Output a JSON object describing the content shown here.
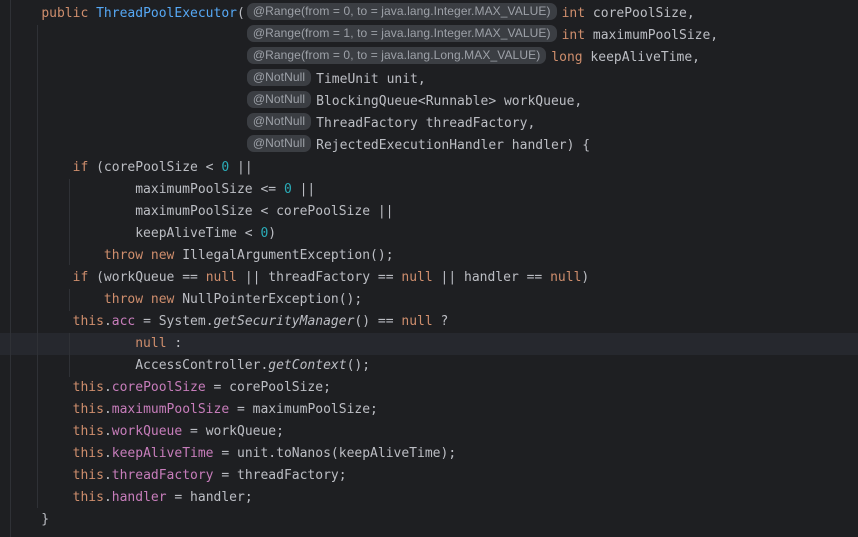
{
  "editor": {
    "background": "#1e1f22",
    "caret_line": {
      "index": 15,
      "color": "#26282e"
    },
    "palette": {
      "plain": "#bcbec4",
      "keyword": "#cf8e6d",
      "declaration": "#56a8f5",
      "number": "#2aacb8",
      "field": "#c77dbb",
      "hint_bg": "#3b3e43",
      "hint_fg": "#9da1a8",
      "guide": "#2f3136",
      "gutter_line": "#2e3035"
    },
    "lines": [
      {
        "segments": [
          {
            "t": "    ",
            "s": "plain"
          },
          {
            "t": "public",
            "s": "kw"
          },
          {
            "t": " ",
            "s": "plain"
          },
          {
            "t": "ThreadPoolExecutor",
            "s": "decl"
          },
          {
            "t": "(",
            "s": "plain"
          },
          {
            "t": "@Range(from = 0, to = java.lang.Integer.MAX_VALUE)",
            "s": "hint"
          },
          {
            "t": "int",
            "s": "kw"
          },
          {
            "t": " corePoolSize,",
            "s": "plain"
          }
        ]
      },
      {
        "segments": [
          {
            "t": "                              ",
            "s": "plain"
          },
          {
            "t": "@Range(from = 1, to = java.lang.Integer.MAX_VALUE)",
            "s": "hint"
          },
          {
            "t": "int",
            "s": "kw"
          },
          {
            "t": " maximumPoolSize,",
            "s": "plain"
          }
        ]
      },
      {
        "segments": [
          {
            "t": "                              ",
            "s": "plain"
          },
          {
            "t": "@Range(from = 0, to = java.lang.Long.MAX_VALUE)",
            "s": "hint"
          },
          {
            "t": "long",
            "s": "kw"
          },
          {
            "t": " keepAliveTime,",
            "s": "plain"
          }
        ]
      },
      {
        "segments": [
          {
            "t": "                              ",
            "s": "plain"
          },
          {
            "t": "@NotNull",
            "s": "hint"
          },
          {
            "t": "TimeUnit unit,",
            "s": "plain"
          }
        ]
      },
      {
        "segments": [
          {
            "t": "                              ",
            "s": "plain"
          },
          {
            "t": "@NotNull",
            "s": "hint"
          },
          {
            "t": "BlockingQueue<Runnable> workQueue,",
            "s": "plain"
          }
        ]
      },
      {
        "segments": [
          {
            "t": "                              ",
            "s": "plain"
          },
          {
            "t": "@NotNull",
            "s": "hint"
          },
          {
            "t": "ThreadFactory threadFactory,",
            "s": "plain"
          }
        ]
      },
      {
        "segments": [
          {
            "t": "                              ",
            "s": "plain"
          },
          {
            "t": "@NotNull",
            "s": "hint"
          },
          {
            "t": "RejectedExecutionHandler handler) {",
            "s": "plain"
          }
        ]
      },
      {
        "segments": [
          {
            "t": "        ",
            "s": "plain"
          },
          {
            "t": "if",
            "s": "kw"
          },
          {
            "t": " (corePoolSize < ",
            "s": "plain"
          },
          {
            "t": "0",
            "s": "num"
          },
          {
            "t": " ||",
            "s": "plain"
          }
        ]
      },
      {
        "segments": [
          {
            "t": "                maximumPoolSize <= ",
            "s": "plain"
          },
          {
            "t": "0",
            "s": "num"
          },
          {
            "t": " ||",
            "s": "plain"
          }
        ]
      },
      {
        "segments": [
          {
            "t": "                maximumPoolSize < corePoolSize ||",
            "s": "plain"
          }
        ]
      },
      {
        "segments": [
          {
            "t": "                keepAliveTime < ",
            "s": "plain"
          },
          {
            "t": "0",
            "s": "num"
          },
          {
            "t": ")",
            "s": "plain"
          }
        ]
      },
      {
        "segments": [
          {
            "t": "            ",
            "s": "plain"
          },
          {
            "t": "throw",
            "s": "kw"
          },
          {
            "t": " ",
            "s": "plain"
          },
          {
            "t": "new",
            "s": "kw"
          },
          {
            "t": " IllegalArgumentException();",
            "s": "plain"
          }
        ]
      },
      {
        "segments": [
          {
            "t": "        ",
            "s": "plain"
          },
          {
            "t": "if",
            "s": "kw"
          },
          {
            "t": " (workQueue == ",
            "s": "plain"
          },
          {
            "t": "null",
            "s": "kw"
          },
          {
            "t": " || threadFactory == ",
            "s": "plain"
          },
          {
            "t": "null",
            "s": "kw"
          },
          {
            "t": " || handler == ",
            "s": "plain"
          },
          {
            "t": "null",
            "s": "kw"
          },
          {
            "t": ")",
            "s": "plain"
          }
        ]
      },
      {
        "segments": [
          {
            "t": "            ",
            "s": "plain"
          },
          {
            "t": "throw",
            "s": "kw"
          },
          {
            "t": " ",
            "s": "plain"
          },
          {
            "t": "new",
            "s": "kw"
          },
          {
            "t": " NullPointerException();",
            "s": "plain"
          }
        ]
      },
      {
        "segments": [
          {
            "t": "        ",
            "s": "plain"
          },
          {
            "t": "this",
            "s": "kw"
          },
          {
            "t": ".",
            "s": "plain"
          },
          {
            "t": "acc",
            "s": "field"
          },
          {
            "t": " = System.",
            "s": "plain"
          },
          {
            "t": "getSecurityManager",
            "s": "static"
          },
          {
            "t": "() == ",
            "s": "plain"
          },
          {
            "t": "null",
            "s": "kw"
          },
          {
            "t": " ?",
            "s": "plain"
          }
        ]
      },
      {
        "segments": [
          {
            "t": "                ",
            "s": "plain"
          },
          {
            "t": "null",
            "s": "kw"
          },
          {
            "t": " :",
            "s": "plain"
          }
        ]
      },
      {
        "segments": [
          {
            "t": "                AccessController.",
            "s": "plain"
          },
          {
            "t": "getContext",
            "s": "static"
          },
          {
            "t": "();",
            "s": "plain"
          }
        ]
      },
      {
        "segments": [
          {
            "t": "        ",
            "s": "plain"
          },
          {
            "t": "this",
            "s": "kw"
          },
          {
            "t": ".",
            "s": "plain"
          },
          {
            "t": "corePoolSize",
            "s": "field"
          },
          {
            "t": " = corePoolSize;",
            "s": "plain"
          }
        ]
      },
      {
        "segments": [
          {
            "t": "        ",
            "s": "plain"
          },
          {
            "t": "this",
            "s": "kw"
          },
          {
            "t": ".",
            "s": "plain"
          },
          {
            "t": "maximumPoolSize",
            "s": "field"
          },
          {
            "t": " = maximumPoolSize;",
            "s": "plain"
          }
        ]
      },
      {
        "segments": [
          {
            "t": "        ",
            "s": "plain"
          },
          {
            "t": "this",
            "s": "kw"
          },
          {
            "t": ".",
            "s": "plain"
          },
          {
            "t": "workQueue",
            "s": "field"
          },
          {
            "t": " = workQueue;",
            "s": "plain"
          }
        ]
      },
      {
        "segments": [
          {
            "t": "        ",
            "s": "plain"
          },
          {
            "t": "this",
            "s": "kw"
          },
          {
            "t": ".",
            "s": "plain"
          },
          {
            "t": "keepAliveTime",
            "s": "field"
          },
          {
            "t": " = unit.toNanos(keepAliveTime);",
            "s": "plain"
          }
        ]
      },
      {
        "segments": [
          {
            "t": "        ",
            "s": "plain"
          },
          {
            "t": "this",
            "s": "kw"
          },
          {
            "t": ".",
            "s": "plain"
          },
          {
            "t": "threadFactory",
            "s": "field"
          },
          {
            "t": " = threadFactory;",
            "s": "plain"
          }
        ]
      },
      {
        "segments": [
          {
            "t": "        ",
            "s": "plain"
          },
          {
            "t": "this",
            "s": "kw"
          },
          {
            "t": ".",
            "s": "plain"
          },
          {
            "t": "handler",
            "s": "field"
          },
          {
            "t": " = handler;",
            "s": "plain"
          }
        ]
      },
      {
        "segments": [
          {
            "t": "    }",
            "s": "plain"
          }
        ]
      }
    ]
  }
}
